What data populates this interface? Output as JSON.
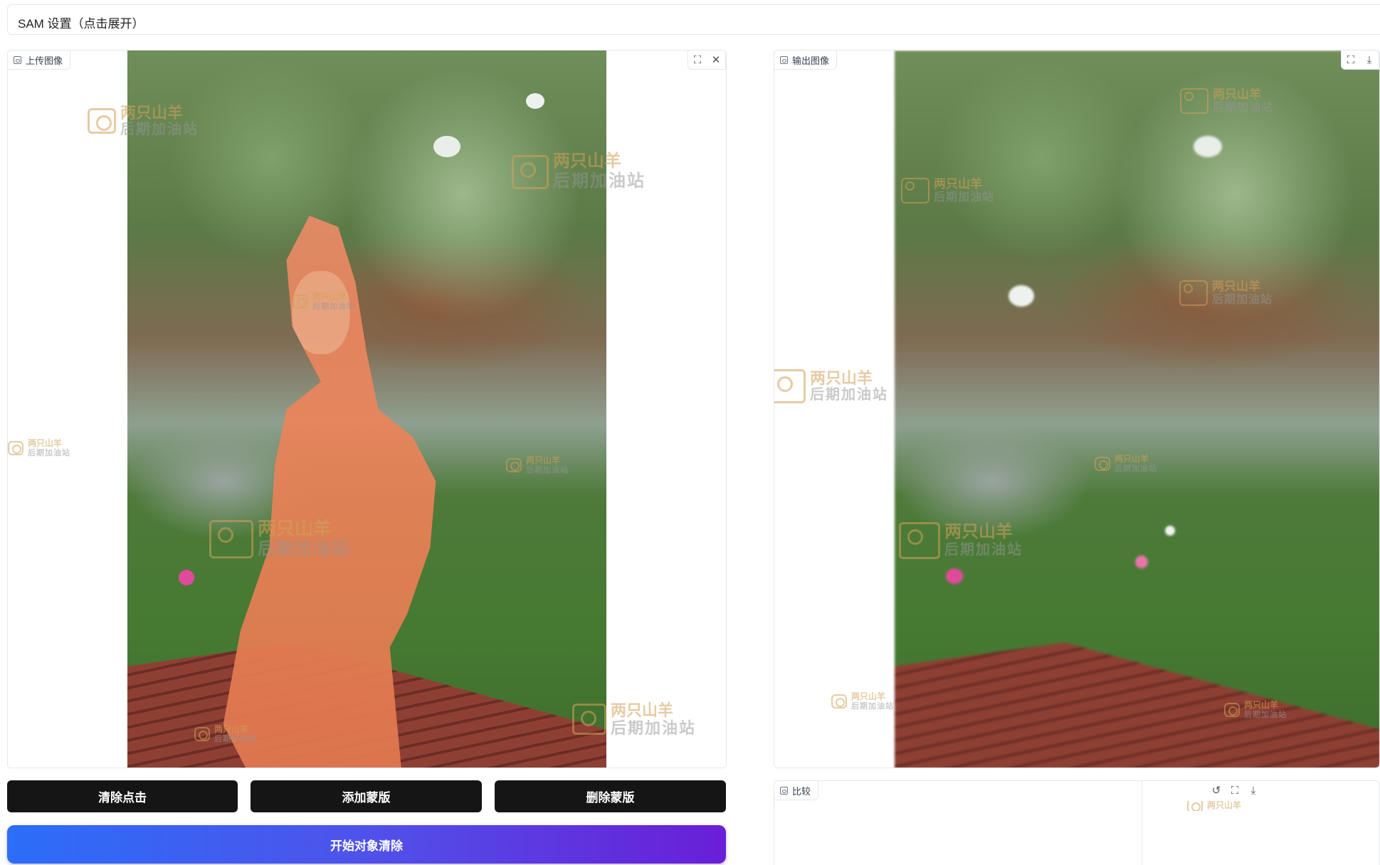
{
  "settings": {
    "label": "SAM 设置（点击展开）"
  },
  "upload_panel": {
    "label": "上传图像"
  },
  "output_panel": {
    "label": "输出图像"
  },
  "compare_panel": {
    "label": "比较"
  },
  "watermark": {
    "line1": "两只山羊",
    "line2": "后期加油站"
  },
  "buttons": {
    "clear_clicks": "清除点击",
    "add_mask": "添加蒙版",
    "delete_mask": "删除蒙版",
    "start_removal": "开始对象清除"
  },
  "icons": {
    "fullscreen": "⛶",
    "close": "✕",
    "download": "⤓",
    "reset": "↺"
  },
  "colors": {
    "button_dark": "#151515",
    "primary_gradient_start": "#2b6ef8",
    "primary_gradient_end": "#6a1ed6",
    "mask_overlay": "#ea8359"
  }
}
